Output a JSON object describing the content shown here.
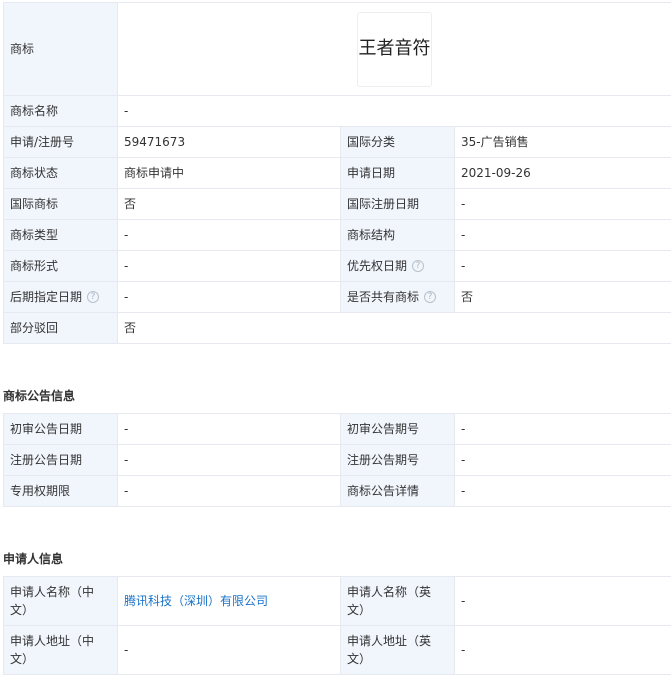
{
  "basic": {
    "trademark_label": "商标",
    "trademark_image_text": "王者音符",
    "name_label": "商标名称",
    "name_value": "-",
    "rows": [
      {
        "l1": "申请/注册号",
        "v1": "59471673",
        "l2": "国际分类",
        "v2": "35-广告销售"
      },
      {
        "l1": "商标状态",
        "v1": "商标申请中",
        "l2": "申请日期",
        "v2": "2021-09-26"
      },
      {
        "l1": "国际商标",
        "v1": "否",
        "l2": "国际注册日期",
        "v2": "-"
      },
      {
        "l1": "商标类型",
        "v1": "-",
        "l2": "商标结构",
        "v2": "-"
      },
      {
        "l1": "商标形式",
        "v1": "-",
        "l2": "优先权日期",
        "v2": "-"
      },
      {
        "l1": "后期指定日期",
        "v1": "-",
        "l2": "是否共有商标",
        "v2": "否"
      }
    ],
    "partial_label": "部分驳回",
    "partial_value": "否"
  },
  "announcement": {
    "title": "商标公告信息",
    "rows": [
      {
        "l1": "初审公告日期",
        "v1": "-",
        "l2": "初审公告期号",
        "v2": "-"
      },
      {
        "l1": "注册公告日期",
        "v1": "-",
        "l2": "注册公告期号",
        "v2": "-"
      },
      {
        "l1": "专用权期限",
        "v1": "-",
        "l2": "商标公告详情",
        "v2": "-"
      }
    ]
  },
  "applicant": {
    "title": "申请人信息",
    "rows": [
      {
        "l1": "申请人名称（中文）",
        "v1": "腾讯科技（深圳）有限公司",
        "l2": "申请人名称（英文）",
        "v2": "-"
      },
      {
        "l1": "申请人地址（中文）",
        "v1": "-",
        "l2": "申请人地址（英文）",
        "v2": "-"
      }
    ]
  },
  "help_icon_glyph": "?",
  "colors": {
    "label_bg": "#f1f6fd",
    "border": "#e6eaf0",
    "link": "#1a73c8"
  }
}
